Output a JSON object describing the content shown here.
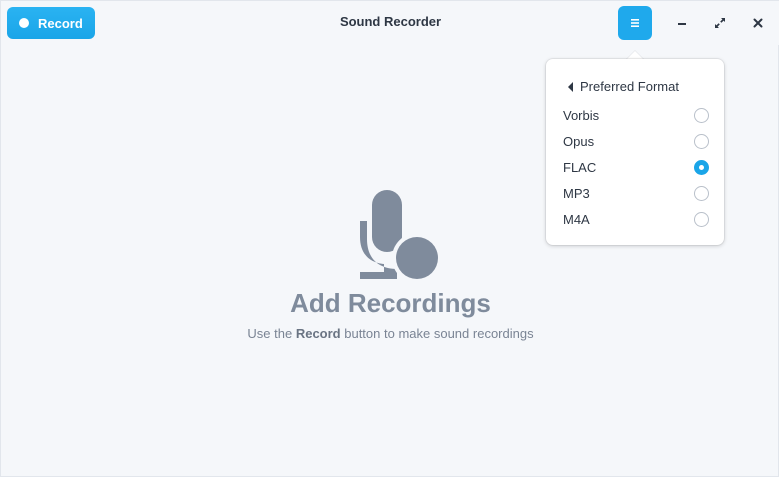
{
  "header": {
    "record_label": "Record",
    "title": "Sound Recorder"
  },
  "popover": {
    "title": "Preferred Format",
    "options": [
      {
        "label": "Vorbis",
        "selected": false
      },
      {
        "label": "Opus",
        "selected": false
      },
      {
        "label": "FLAC",
        "selected": true
      },
      {
        "label": "MP3",
        "selected": false
      },
      {
        "label": "M4A",
        "selected": false
      }
    ]
  },
  "empty": {
    "title": "Add Recordings",
    "subtitle_prefix": "Use the ",
    "subtitle_bold": "Record",
    "subtitle_suffix": " button to make sound recordings"
  },
  "colors": {
    "accent": "#1aa5e8",
    "icon_gray": "#7f8b9c"
  },
  "icons": {
    "record": "record-dot-icon",
    "menu": "hamburger-menu-icon",
    "minimize": "minimize-icon",
    "maximize": "maximize-icon",
    "close": "close-icon",
    "back": "back-triangle-icon",
    "empty": "microphone-icon"
  }
}
